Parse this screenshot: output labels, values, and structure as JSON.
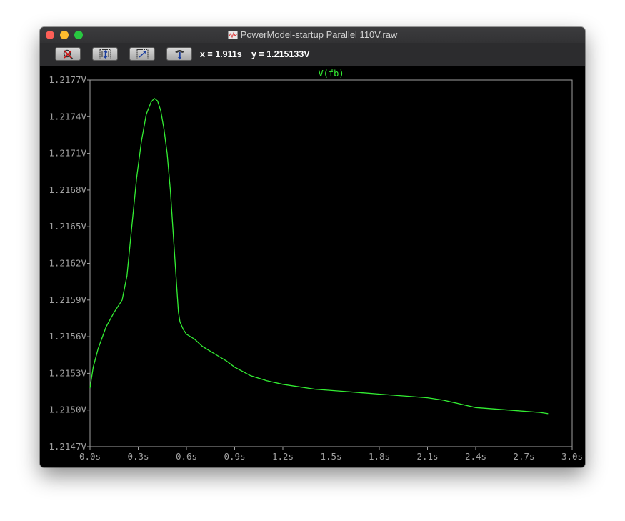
{
  "window": {
    "title": "PowerModel-startup Parallel 110V.raw",
    "title_icon": "waveform-file-icon"
  },
  "toolbar": {
    "buttons": [
      {
        "name": "zoom-cancel-button",
        "icon": "magnifier-cancel-icon"
      },
      {
        "name": "autorange-y-button",
        "icon": "vertical-autorange-icon"
      },
      {
        "name": "autorange-xy-button",
        "icon": "diagonal-zoom-icon"
      },
      {
        "name": "probe-button",
        "icon": "probe-icon"
      }
    ],
    "x_readout": "x = 1.911s",
    "y_readout": "y = 1.215133V"
  },
  "colors": {
    "trace": "#33ee33",
    "axis": "#a0a0a0",
    "background": "#000000"
  },
  "chart_data": {
    "type": "line",
    "title": "V(fb)",
    "xlabel": "",
    "ylabel": "",
    "xlim": [
      0.0,
      3.0
    ],
    "ylim": [
      1.2147,
      1.2177
    ],
    "x_ticks": [
      "0.0s",
      "0.3s",
      "0.6s",
      "0.9s",
      "1.2s",
      "1.5s",
      "1.8s",
      "2.1s",
      "2.4s",
      "2.7s",
      "3.0s"
    ],
    "y_ticks": [
      "1.2177V",
      "1.2174V",
      "1.2171V",
      "1.2168V",
      "1.2165V",
      "1.2162V",
      "1.2159V",
      "1.2156V",
      "1.2153V",
      "1.2150V",
      "1.2147V"
    ],
    "grid": false,
    "series": [
      {
        "name": "V(fb)",
        "x": [
          0.0,
          0.02,
          0.05,
          0.1,
          0.15,
          0.2,
          0.23,
          0.26,
          0.29,
          0.32,
          0.35,
          0.38,
          0.4,
          0.42,
          0.44,
          0.46,
          0.48,
          0.5,
          0.52,
          0.54,
          0.55,
          0.56,
          0.58,
          0.6,
          0.65,
          0.7,
          0.8,
          0.85,
          0.9,
          1.0,
          1.1,
          1.2,
          1.4,
          1.6,
          1.8,
          2.0,
          2.1,
          2.2,
          2.3,
          2.4,
          2.6,
          2.8,
          2.85
        ],
        "y": [
          1.21518,
          1.21535,
          1.2155,
          1.21568,
          1.2158,
          1.2159,
          1.2161,
          1.2165,
          1.2169,
          1.2172,
          1.21742,
          1.21752,
          1.21755,
          1.21753,
          1.21745,
          1.2173,
          1.2171,
          1.2168,
          1.2164,
          1.216,
          1.2158,
          1.21572,
          1.21566,
          1.21562,
          1.21558,
          1.21552,
          1.21544,
          1.2154,
          1.21535,
          1.21528,
          1.21524,
          1.21521,
          1.21517,
          1.21515,
          1.21513,
          1.21511,
          1.2151,
          1.21508,
          1.21505,
          1.21502,
          1.215,
          1.21498,
          1.21497
        ]
      }
    ]
  }
}
